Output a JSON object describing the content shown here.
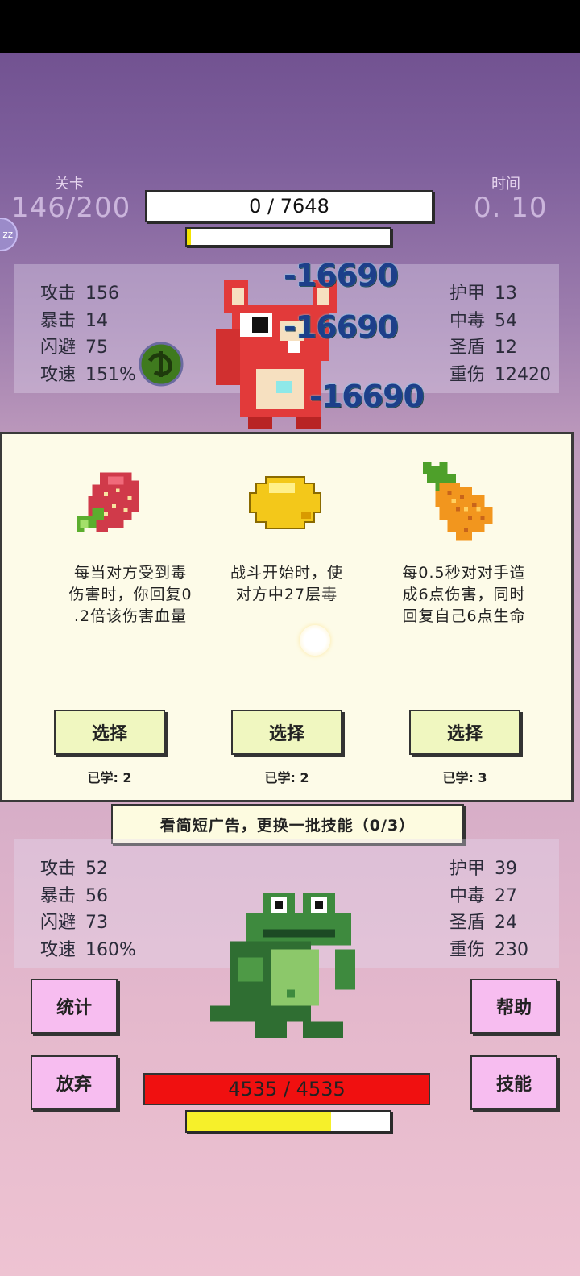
{
  "header": {
    "level_label": "关卡",
    "level_value": "146/200",
    "time_label": "时间",
    "time_value": "0. 10"
  },
  "enemy": {
    "hp_text": "0  /  7648",
    "bar_fill_fraction": 0.02,
    "stats_left": [
      {
        "label": "攻击",
        "value": "156"
      },
      {
        "label": "暴击",
        "value": "14"
      },
      {
        "label": "闪避",
        "value": "75"
      },
      {
        "label": "攻速",
        "value": "151%"
      }
    ],
    "stats_right": [
      {
        "label": "护甲",
        "value": "13"
      },
      {
        "label": "中毒",
        "value": "54"
      },
      {
        "label": "圣盾",
        "value": "12"
      },
      {
        "label": "重伤",
        "value": "12420"
      }
    ],
    "damage_numbers": [
      "-16690",
      "-16690",
      "-16690"
    ]
  },
  "choices": [
    {
      "icon": "strawberry-icon",
      "desc_lines": [
        "每当对方受到毒",
        "伤害时，你回复0",
        ".2倍该伤害血量"
      ],
      "button": "选择",
      "learned": "已学: 2"
    },
    {
      "icon": "lemon-icon",
      "desc_lines": [
        "战斗开始时，使",
        "对方中27层毒"
      ],
      "button": "选择",
      "learned": "已学: 2"
    },
    {
      "icon": "pineapple-icon",
      "desc_lines": [
        "每0.5秒对对手造",
        "成6点伤害，同时",
        "回复自己6点生命"
      ],
      "button": "选择",
      "learned": "已学: 3"
    }
  ],
  "ad_banner": "看简短广告，更换一批技能（0/3）",
  "player": {
    "stats_left": [
      {
        "label": "攻击",
        "value": "52"
      },
      {
        "label": "暴击",
        "value": "56"
      },
      {
        "label": "闪避",
        "value": "73"
      },
      {
        "label": "攻速",
        "value": "160%"
      }
    ],
    "stats_right": [
      {
        "label": "护甲",
        "value": "39"
      },
      {
        "label": "中毒",
        "value": "27"
      },
      {
        "label": "圣盾",
        "value": "24"
      },
      {
        "label": "重伤",
        "value": "230"
      }
    ],
    "hp_text": "4535  /  4535",
    "bar_fill_fraction": 0.71
  },
  "buttons": {
    "stats": "统计",
    "help": "帮助",
    "give_up": "放弃",
    "skills": "技能"
  },
  "sleep_badge": "zz"
}
